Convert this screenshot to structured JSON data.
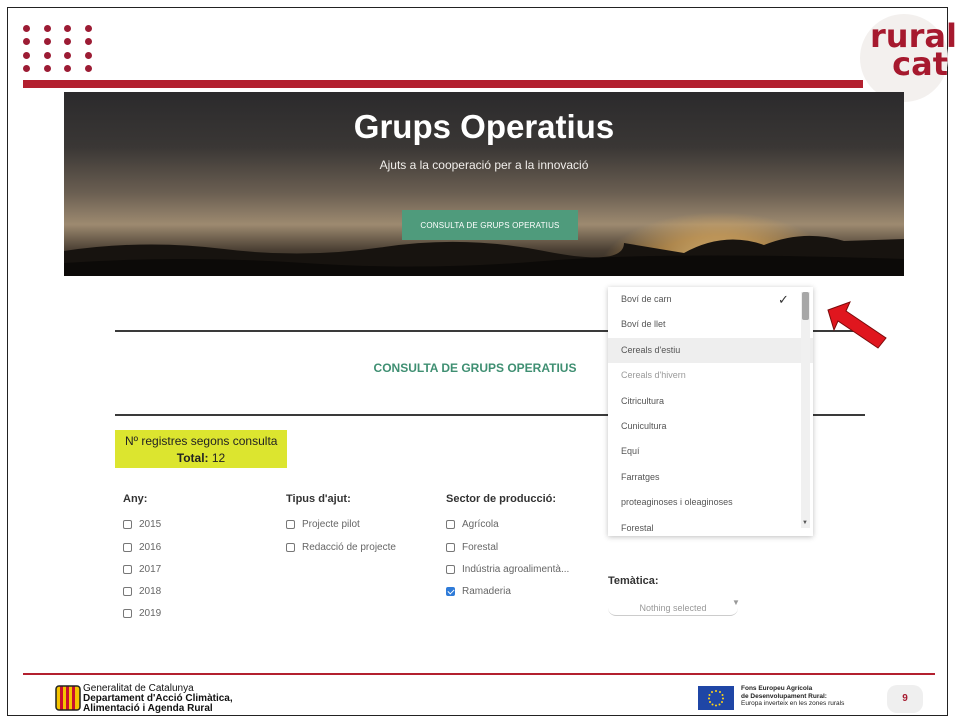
{
  "brand": {
    "logo_line1": "rural",
    "logo_line2": "cat"
  },
  "hero": {
    "title": "Grups Operatius",
    "subtitle": "Ajuts a la cooperació per a la innovació",
    "button_label": "CONSULTA DE GRUPS OPERATIUS"
  },
  "section_title": "CONSULTA DE GRUPS OPERATIUS",
  "results": {
    "label": "Nº registres segons consulta",
    "total_label": "Total:",
    "total_value": "12"
  },
  "filters": {
    "any": {
      "label": "Any:",
      "options": [
        "2015",
        "2016",
        "2017",
        "2018",
        "2019"
      ]
    },
    "tipus": {
      "label": "Tipus d'ajut:",
      "options": [
        "Projecte pilot",
        "Redacció de projecte"
      ]
    },
    "sector": {
      "label": "Sector de producció:",
      "options": [
        "Agrícola",
        "Forestal",
        "Indústria agroalimentà...",
        "Ramaderia"
      ],
      "checked": "Ramaderia"
    },
    "tematica": {
      "label": "Temàtica:",
      "placeholder": "Nothing selected"
    }
  },
  "dropdown": {
    "items": [
      "Boví de carn",
      "Boví de llet",
      "Cereals d'estiu",
      "Cereals d'hivern",
      "Citricultura",
      "Cunicultura",
      "Equí",
      "Farratges",
      "proteaginoses i oleaginoses",
      "Forestal"
    ],
    "selected": "Boví de carn",
    "highlighted": "Cereals d'estiu"
  },
  "footer": {
    "gen_line1": "Generalitat de Catalunya",
    "gen_line2": "Departament d'Acció Climàtica,",
    "gen_line3": "Alimentació i Agenda Rural",
    "fons_line1": "Fons Europeu Agrícola",
    "fons_line2": "de Desenvolupament Rural:",
    "fons_line3": "Europa inverteix en les zones rurals",
    "page_number": "9"
  },
  "colors": {
    "brand_red": "#b3202f",
    "accent_green": "#4f9b7c",
    "highlight_yellow": "#dce52f",
    "arrow_red": "#e0161e"
  }
}
